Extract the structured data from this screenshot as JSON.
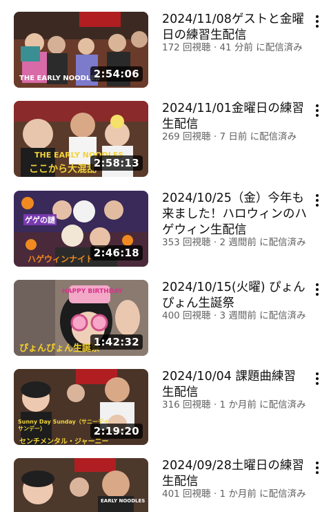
{
  "videos": [
    {
      "title": "2024/11/08ゲストと金曜日の練習生配信",
      "views": "172 回視聴",
      "age": "41 分前",
      "status": "に配信済み",
      "duration": "2:54:06",
      "thumb_text": "THE EARLY NOODLES"
    },
    {
      "title": "2024/11/01金曜日の練習生配信",
      "views": "269 回視聴",
      "age": "7 日前",
      "status": "に配信済み",
      "duration": "2:58:13",
      "thumb_text": "THE EARLY NOODLES",
      "thumb_text2": "ここから大混乱"
    },
    {
      "title": "2024/10/25（金）今年も来ました！ハロウィンのハゲウィン生配信",
      "views": "353 回視聴",
      "age": "2 週間前",
      "status": "に配信済み",
      "duration": "2:46:18",
      "thumb_text": "ゲゲの謎",
      "thumb_text2": "ハゲウィンナイト"
    },
    {
      "title": "2024/10/15(火曜) ぴょんぴょん生誕祭",
      "views": "400 回視聴",
      "age": "3 週間前",
      "status": "に配信済み",
      "duration": "1:42:32",
      "thumb_text": "HAPPY BIRTHDAY",
      "thumb_text2": "ぴょんぴょん生誕祭"
    },
    {
      "title": "2024/10/04 課題曲練習生配信",
      "views": "316 回視聴",
      "age": "1 か月前",
      "status": "に配信済み",
      "duration": "2:19:20",
      "thumb_text": "Sunny Day Sunday（サニーデイ・サンデー）",
      "thumb_text2": "センチメンタル・ジャーニー"
    },
    {
      "title": "2024/09/28土曜日の練習生配信",
      "views": "401 回視聴",
      "age": "1 か月前",
      "status": "に配信済み",
      "duration": "",
      "thumb_text": "EARLY NOODLES"
    }
  ],
  "meta_separator": " · ",
  "icons": {
    "more": "more-vert-icon"
  }
}
